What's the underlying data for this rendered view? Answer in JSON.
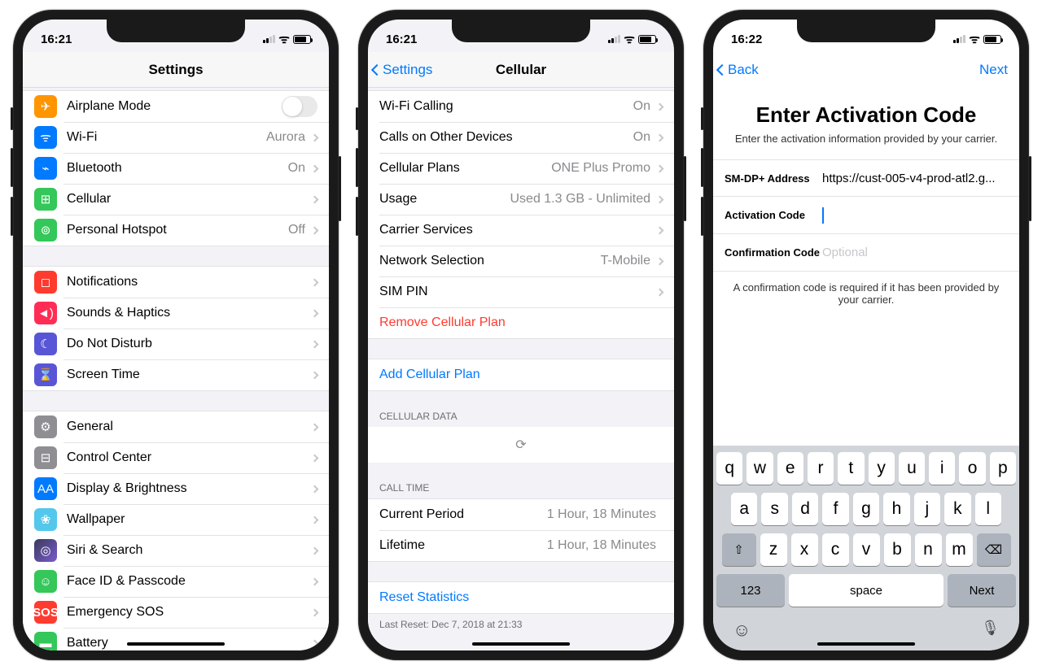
{
  "status": {
    "time1": "16:21",
    "time2": "16:21",
    "time3": "16:22"
  },
  "phone1": {
    "title": "Settings",
    "groups": [
      [
        {
          "icon": "airplane",
          "label": "Airplane Mode",
          "toggle": true
        },
        {
          "icon": "wifi",
          "label": "Wi-Fi",
          "value": "Aurora",
          "nav": true
        },
        {
          "icon": "bt",
          "label": "Bluetooth",
          "value": "On",
          "nav": true
        },
        {
          "icon": "cell",
          "label": "Cellular",
          "nav": true
        },
        {
          "icon": "hotspot",
          "label": "Personal Hotspot",
          "value": "Off",
          "nav": true
        }
      ],
      [
        {
          "icon": "notif",
          "label": "Notifications",
          "nav": true
        },
        {
          "icon": "sounds",
          "label": "Sounds & Haptics",
          "nav": true
        },
        {
          "icon": "dnd",
          "label": "Do Not Disturb",
          "nav": true
        },
        {
          "icon": "screen",
          "label": "Screen Time",
          "nav": true
        }
      ],
      [
        {
          "icon": "general",
          "label": "General",
          "nav": true
        },
        {
          "icon": "cc",
          "label": "Control Center",
          "nav": true
        },
        {
          "icon": "display",
          "label": "Display & Brightness",
          "nav": true
        },
        {
          "icon": "wall",
          "label": "Wallpaper",
          "nav": true
        },
        {
          "icon": "siri",
          "label": "Siri & Search",
          "nav": true
        },
        {
          "icon": "faceid",
          "label": "Face ID & Passcode",
          "nav": true
        },
        {
          "icon": "sos",
          "label": "Emergency SOS",
          "nav": true
        },
        {
          "icon": "batt",
          "label": "Battery",
          "nav": true
        }
      ]
    ]
  },
  "phone2": {
    "back": "Settings",
    "title": "Cellular",
    "rows1": [
      {
        "label": "Wi-Fi Calling",
        "value": "On",
        "nav": true
      },
      {
        "label": "Calls on Other Devices",
        "value": "On",
        "nav": true
      },
      {
        "label": "Cellular Plans",
        "value": "ONE Plus Promo",
        "nav": true
      },
      {
        "label": "Usage",
        "value": "Used 1.3 GB - Unlimited",
        "nav": true
      },
      {
        "label": "Carrier Services",
        "nav": true
      },
      {
        "label": "Network Selection",
        "value": "T-Mobile",
        "nav": true
      },
      {
        "label": "SIM PIN",
        "nav": true
      },
      {
        "label": "Remove Cellular Plan",
        "destructive": true
      }
    ],
    "rows2": [
      {
        "label": "Add Cellular Plan",
        "link": true
      }
    ],
    "header1": "CELLULAR DATA",
    "header2": "CALL TIME",
    "calltime": [
      {
        "label": "Current Period",
        "value": "1 Hour, 18 Minutes"
      },
      {
        "label": "Lifetime",
        "value": "1 Hour, 18 Minutes"
      }
    ],
    "reset": "Reset Statistics",
    "footer": "Last Reset: Dec 7, 2018 at 21:33"
  },
  "phone3": {
    "back": "Back",
    "next": "Next",
    "title": "Enter Activation Code",
    "subtitle": "Enter the activation information provided by your carrier.",
    "fields": [
      {
        "label": "SM-DP+ Address",
        "value": "https://cust-005-v4-prod-atl2.g..."
      },
      {
        "label": "Activation Code",
        "value": "",
        "focused": true
      },
      {
        "label": "Confirmation Code",
        "placeholder": "Optional"
      }
    ],
    "note": "A confirmation code is required if it has been provided by your carrier.",
    "keyboard": {
      "row1": [
        "q",
        "w",
        "e",
        "r",
        "t",
        "y",
        "u",
        "i",
        "o",
        "p"
      ],
      "row2": [
        "a",
        "s",
        "d",
        "f",
        "g",
        "h",
        "j",
        "k",
        "l"
      ],
      "row3": [
        "z",
        "x",
        "c",
        "v",
        "b",
        "n",
        "m"
      ],
      "shift": "⇧",
      "backspace": "⌫",
      "num": "123",
      "space": "space",
      "go": "Next",
      "emoji": "☺",
      "mic": "🎤"
    }
  },
  "icon_glyphs": {
    "airplane": "✈",
    "wifi": "ᯤ",
    "bt": "⌁",
    "cell": "⊞",
    "hotspot": "⊚",
    "notif": "◻",
    "sounds": "◄)",
    "dnd": "☾",
    "screen": "⌛",
    "general": "⚙",
    "cc": "⊟",
    "display": "AA",
    "wall": "❀",
    "siri": "◎",
    "faceid": "☺",
    "sos": "SOS",
    "batt": "▬"
  }
}
